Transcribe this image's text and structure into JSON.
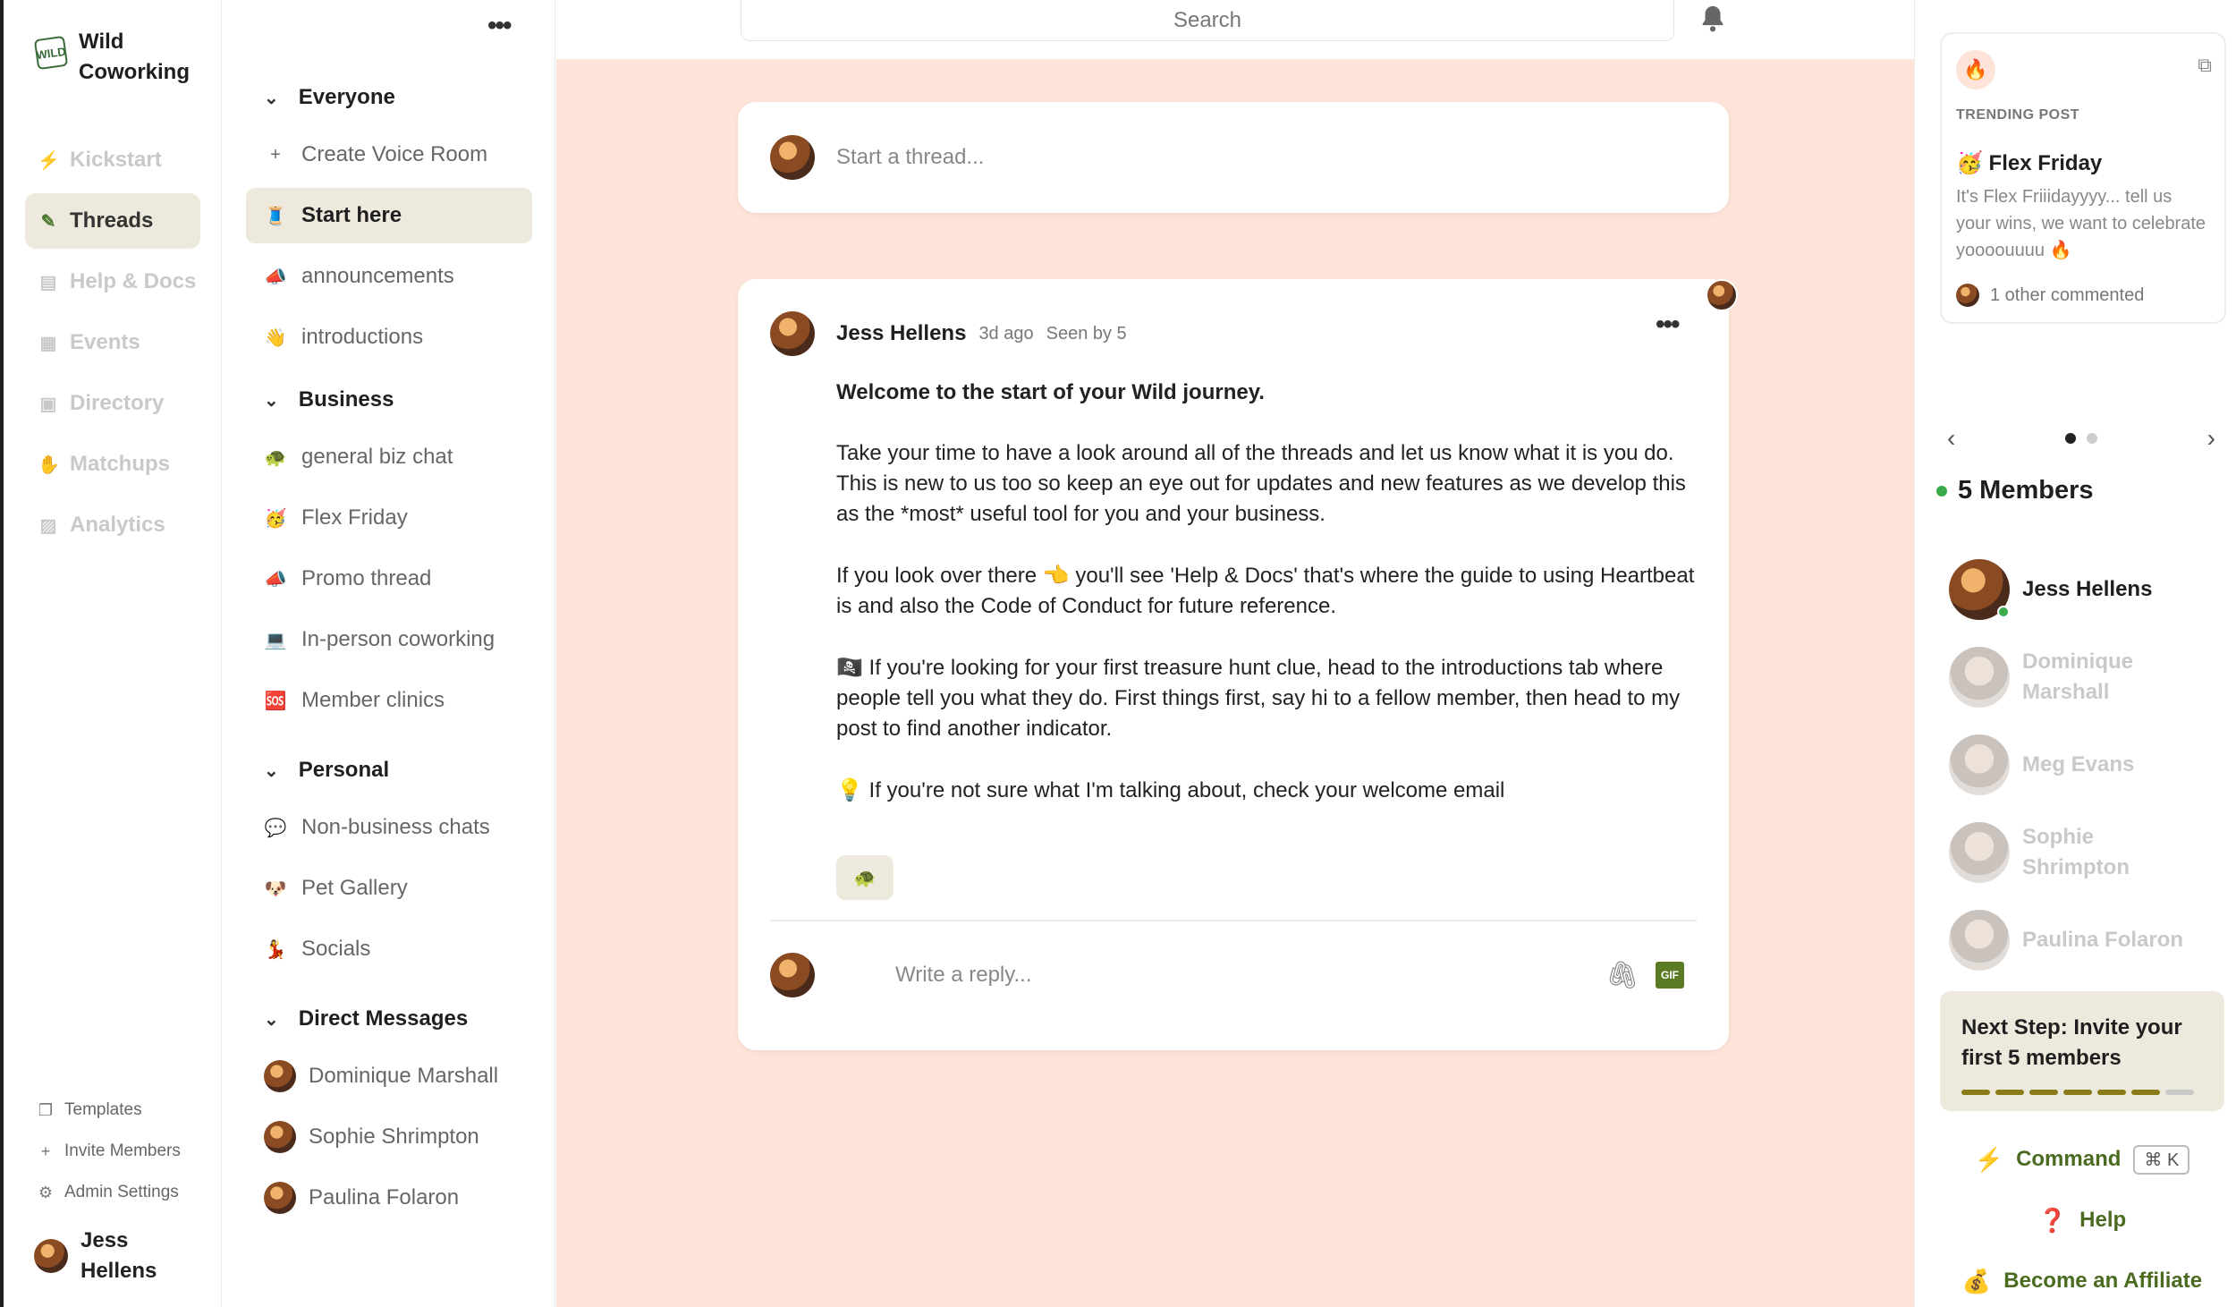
{
  "brand": {
    "name": "Wild Coworking",
    "logo_text": "WILD"
  },
  "main_nav": [
    {
      "label": "Kickstart",
      "icon": "bolt-icon",
      "active": false
    },
    {
      "label": "Threads",
      "icon": "feather-icon",
      "active": true
    },
    {
      "label": "Help & Docs",
      "icon": "document-icon",
      "active": false
    },
    {
      "label": "Events",
      "icon": "calendar-icon",
      "active": false
    },
    {
      "label": "Directory",
      "icon": "contacts-icon",
      "active": false
    },
    {
      "label": "Matchups",
      "icon": "hand-icon",
      "active": false
    },
    {
      "label": "Analytics",
      "icon": "chart-icon",
      "active": false
    }
  ],
  "bottom_nav": {
    "templates": "Templates",
    "invite": "Invite Members",
    "admin": "Admin Settings"
  },
  "current_user": {
    "name": "Jess Hellens"
  },
  "channels": {
    "sections": [
      {
        "title": "Everyone",
        "items": [
          {
            "label": "Create Voice Room",
            "emoji": "+",
            "active": false
          },
          {
            "label": "Start here",
            "emoji": "🧵",
            "active": true
          },
          {
            "label": "announcements",
            "emoji": "📣",
            "active": false
          },
          {
            "label": "introductions",
            "emoji": "👋",
            "active": false
          }
        ]
      },
      {
        "title": "Business",
        "items": [
          {
            "label": "general biz chat",
            "emoji": "🐢",
            "active": false
          },
          {
            "label": "Flex Friday",
            "emoji": "🥳",
            "active": false
          },
          {
            "label": "Promo thread",
            "emoji": "📣",
            "active": false
          },
          {
            "label": "In-person coworking",
            "emoji": "💻",
            "active": false
          },
          {
            "label": "Member clinics",
            "emoji": "🆘",
            "active": false
          }
        ]
      },
      {
        "title": "Personal",
        "items": [
          {
            "label": "Non-business chats",
            "emoji": "💬",
            "active": false
          },
          {
            "label": "Pet Gallery",
            "emoji": "🐶",
            "active": false
          },
          {
            "label": "Socials",
            "emoji": "💃",
            "active": false
          }
        ]
      },
      {
        "title": "Direct Messages",
        "items": [
          {
            "label": "Dominique Marshall"
          },
          {
            "label": "Sophie Shrimpton"
          },
          {
            "label": "Paulina Folaron"
          }
        ]
      }
    ]
  },
  "search": {
    "placeholder": "Search"
  },
  "composer": {
    "placeholder": "Start a thread..."
  },
  "post": {
    "author": "Jess Hellens",
    "time": "3d ago",
    "seen": "Seen by 5",
    "title": "Welcome to the start of your Wild journey.",
    "paragraphs": [
      "Take your time to have a look around all of the threads and let us know what it is you do. This is new to us too so keep an eye out for updates and new features as we develop this as the *most* useful tool for you and your business.",
      "If you look over there 👈 you'll see 'Help & Docs' that's where the guide to using Heartbeat is and also the Code of Conduct for future reference.",
      "🏴‍☠️ If you're looking for your first treasure hunt clue, head to the introductions tab where people tell you what they do. First things first, say hi to a fellow member, then head to my post to find another indicator.",
      "💡 If you're not sure what I'm talking about, check your welcome email"
    ],
    "reaction_icon": "🐢",
    "reply_placeholder": "Write a reply...",
    "gif_label": "GIF"
  },
  "trending": {
    "label": "TRENDING POST",
    "title": "🥳 Flex Friday",
    "excerpt": "It's Flex Friiidayyyy... tell us your wins, we want to celebrate yoooouuuu 🔥",
    "comments": "1 other commented"
  },
  "carousel": {
    "total": 2,
    "current": 1
  },
  "members": {
    "heading": "5 Members",
    "list": [
      {
        "name": "Jess Hellens",
        "online": true
      },
      {
        "name": "Dominique Marshall",
        "online": false
      },
      {
        "name": "Meg Evans",
        "online": false
      },
      {
        "name": "Sophie Shrimpton",
        "online": false
      },
      {
        "name": "Paulina Folaron",
        "online": false
      }
    ]
  },
  "next_step": {
    "title": "Next Step: Invite your first 5 members",
    "segments_total": 7,
    "segments_done": 6
  },
  "links": {
    "command": "Command",
    "command_shortcut": "⌘ K",
    "help": "Help",
    "affiliate": "Become an Affiliate"
  },
  "colors": {
    "accent_green": "#4a6b20",
    "main_bg": "#fde3d8",
    "active_bg": "#ede9dd"
  }
}
